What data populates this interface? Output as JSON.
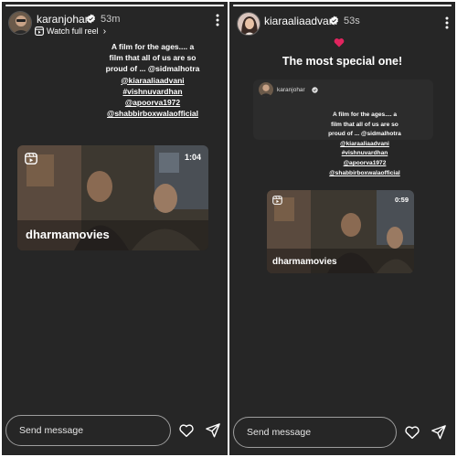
{
  "left_story": {
    "progress_fraction": 1.0,
    "username": "karanjohar",
    "time": "53m",
    "watch_full_reel": "Watch full reel",
    "caption_lines": [
      {
        "text": "A film for the ages.... a",
        "tag": false
      },
      {
        "text": "film that all of us are so",
        "tag": false
      },
      {
        "text": "proud of ... @sidmalhotra",
        "tag": false
      },
      {
        "text": "@kiaraaliaadvani",
        "tag": true
      },
      {
        "text": "#vishnuvardhan",
        "tag": true
      },
      {
        "text": "@apoorva1972",
        "tag": true
      },
      {
        "text": "@shabbirboxwalaofficial",
        "tag": true
      }
    ],
    "reel": {
      "duration": "1:04",
      "brand": "dharmamovies"
    },
    "send_placeholder": "Send message"
  },
  "right_story": {
    "progress_fraction": 1.0,
    "username": "kiaraaliaadvani",
    "time": "53s",
    "emoji": "❤",
    "headline": "The most special one!",
    "shared_post": {
      "username": "karanjohar",
      "caption_lines": [
        {
          "text": "A film for the ages.... a",
          "tag": false
        },
        {
          "text": "film that all of us are so",
          "tag": false
        },
        {
          "text": "proud of ... @sidmalhotra",
          "tag": false
        },
        {
          "text": "@kiaraaliaadvani",
          "tag": true
        },
        {
          "text": "#vishnuvardhan",
          "tag": true
        },
        {
          "text": "@apoorva1972",
          "tag": true
        },
        {
          "text": "@shabbirboxwalaofficial",
          "tag": true
        }
      ]
    },
    "reel": {
      "duration": "0:59",
      "brand": "dharmamovies"
    },
    "send_placeholder": "Send message"
  },
  "colors": {
    "story_background": "#262626",
    "verified_badge": "#ffffff",
    "heart_emoji": "#e0245e",
    "text": "#ffffff"
  },
  "icons": [
    "verified-badge-icon",
    "more-options-icon",
    "reel-icon",
    "chevron-right-icon",
    "heart-icon",
    "send-icon",
    "heart-emoji"
  ]
}
